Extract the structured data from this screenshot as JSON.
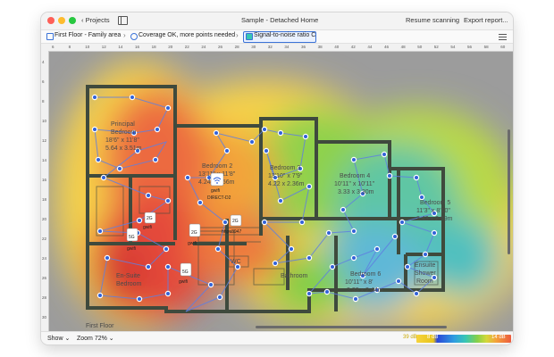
{
  "window": {
    "title": "Sample - Detached Home",
    "back_label": "Projects",
    "resume_label": "Resume scanning",
    "export_label": "Export report..."
  },
  "breadcrumbs": [
    {
      "label": "First Floor - Family area"
    },
    {
      "label": "Coverage OK, more points needed"
    },
    {
      "label": "Signal-to-noise ratio C"
    }
  ],
  "ruler": {
    "h_ticks": [
      "6",
      "8",
      "10",
      "12",
      "14",
      "16",
      "18",
      "20",
      "22",
      "24",
      "26",
      "28",
      "30",
      "32",
      "34",
      "36",
      "38",
      "40",
      "42",
      "44",
      "46",
      "48",
      "50",
      "52",
      "54",
      "56",
      "58",
      "60"
    ],
    "v_ticks": [
      "4",
      "6",
      "8",
      "10",
      "12",
      "14",
      "16",
      "18",
      "20",
      "22",
      "24",
      "26",
      "28",
      "30"
    ]
  },
  "rooms": [
    {
      "name": "Principal",
      "l2": "Bedroom",
      "l3": "18'6\" x 11'8\"",
      "l4": "5.64 x 3.51m"
    },
    {
      "name": "Bedroom 2",
      "l2": "13'11\" x 11'8\"",
      "l3": "4.24 x 3.56m"
    },
    {
      "name": "Bedroom 3",
      "l2": "13'10\" x 7'9\"",
      "l3": "4.22 x 2.36m"
    },
    {
      "name": "Bedroom 4",
      "l2": "10'11\" x 10'11\"",
      "l3": "3.33 x 3.30m"
    },
    {
      "name": "Bedroom 5",
      "l2": "11'3\" x 8'10\"",
      "l3": "3.43 x 2.69m"
    },
    {
      "name": "Bedroom 6",
      "l2": "10'11\" x 8'",
      "l3": "3.33 x 2.44m"
    },
    {
      "name": "Ensuite",
      "l2": "Shower",
      "l3": "Room"
    },
    {
      "name": "Bathroom"
    },
    {
      "name": "En-Suite",
      "l2": "Bedroom"
    },
    {
      "name": "WC"
    },
    {
      "name": "First Floor"
    }
  ],
  "access_points": [
    {
      "band": "2G",
      "name": "gwifi"
    },
    {
      "band": "5G",
      "name": "gwifi"
    },
    {
      "band": "2G",
      "name": "gwifi"
    },
    {
      "band": "5G",
      "name": "gwifi"
    },
    {
      "band": "",
      "name": "gwifi",
      "extra": "DIRECT-D2"
    },
    {
      "band": "2G",
      "name": "hhpu3947"
    }
  ],
  "status": {
    "show_label": "Show",
    "zoom_label": "Zoom 72%",
    "legend_min": "39 dB",
    "legend_mid": "8 dB",
    "legend_max": "14 dB"
  },
  "colors": {
    "accent": "#3b73d8",
    "heat_red": "#e4483a",
    "heat_green": "#7fcf47",
    "heat_yellow": "#f4d43c",
    "wall": "#3f4a3d",
    "point": "#3262d8"
  }
}
